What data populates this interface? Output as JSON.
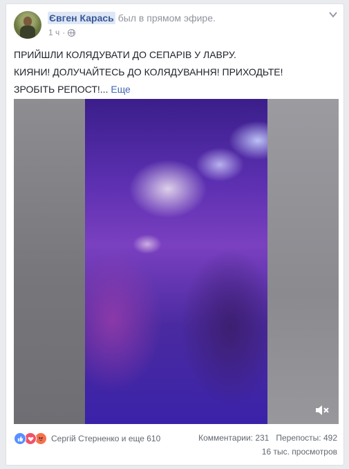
{
  "post": {
    "author": "Євген Карась",
    "action": "был в прямом эфире.",
    "time": "1 ч",
    "text_lines": [
      "ПРИЙШЛИ КОЛЯДУВАТИ ДО СЕПАРІВ У ЛАВРУ.",
      "КИЯНИ! ДОЛУЧАЙТЕСЬ ДО КОЛЯДУВАННЯ! ПРИХОДЬТЕ!",
      "ЗРОБІТЬ РЕПОСТ!..."
    ],
    "more_label": "Еще",
    "icons": {
      "privacy": "globe-icon",
      "options": "chevron-down-icon",
      "mute": "speaker-muted-icon"
    }
  },
  "reactions": {
    "types": [
      "like",
      "love",
      "angry"
    ],
    "summary": "Сергій Стерненко и еще 610"
  },
  "stats": {
    "comments": "Комментарии: 231",
    "shares": "Перепосты: 492",
    "views": "16 тыс. просмотров"
  },
  "colors": {
    "link": "#385898",
    "secondary_text": "#90949c",
    "like": "#5890ff",
    "love": "#f25268",
    "angry": "#f7714b"
  }
}
